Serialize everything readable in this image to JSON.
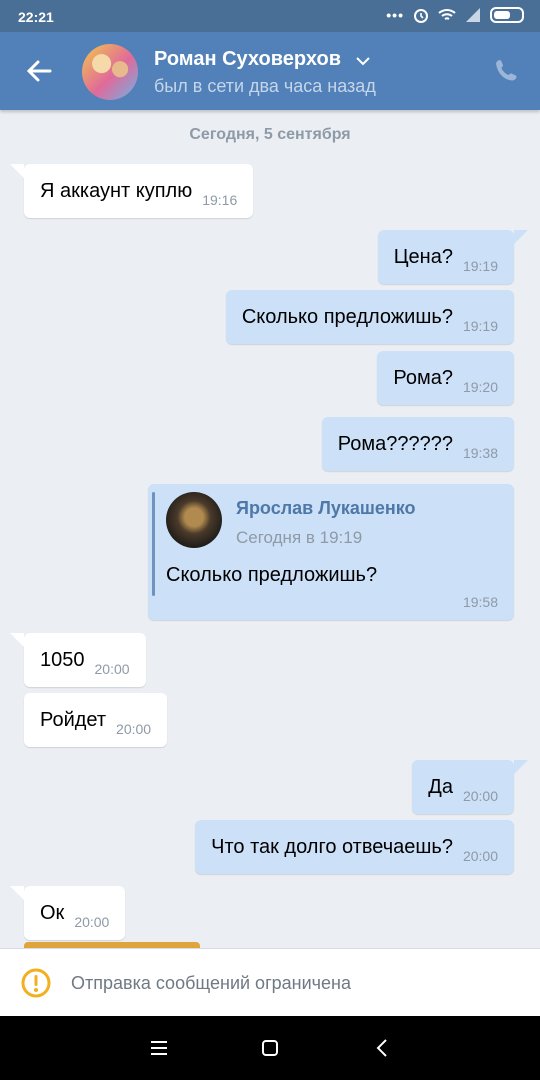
{
  "status_bar": {
    "time": "22:21",
    "icons": [
      "more-dots-icon",
      "alarm-icon",
      "wifi-icon",
      "signal-icon",
      "battery-icon"
    ]
  },
  "header": {
    "contact_name": "Роман Суховерхов",
    "contact_status": "был в сети два часа назад",
    "accent_color": "#5181b8"
  },
  "chat": {
    "date_separator": "Сегодня, 5 сентября",
    "messages": [
      {
        "direction": "in",
        "text": "Я аккаунт куплю",
        "time": "19:16"
      },
      {
        "direction": "out",
        "text": "Цена?",
        "time": "19:19"
      },
      {
        "direction": "out",
        "text": "Сколько предложишь?",
        "time": "19:19"
      },
      {
        "direction": "out",
        "text": "Рома?",
        "time": "19:20"
      },
      {
        "direction": "out",
        "text": "Рома??????",
        "time": "19:38"
      },
      {
        "direction": "in",
        "text": "1050",
        "time": "20:00"
      },
      {
        "direction": "in",
        "text": "Ройдет",
        "time": "20:00"
      },
      {
        "direction": "out",
        "text": "Да",
        "time": "20:00"
      },
      {
        "direction": "out",
        "text": "Что так долго отвечаешь?",
        "time": "20:00"
      },
      {
        "direction": "in",
        "text": "Ок",
        "time": "20:00"
      }
    ],
    "forwarded": {
      "author": "Ярослав Лукашенко",
      "date": "Сегодня в 19:19",
      "text": "Сколько предложишь?",
      "time": "19:58"
    }
  },
  "notice": {
    "text": "Отправка сообщений ограничена",
    "icon": "warning-icon",
    "color": "#f2b01e"
  },
  "nav_bar": {
    "buttons": [
      "menu-icon",
      "home-icon",
      "back-icon"
    ]
  }
}
